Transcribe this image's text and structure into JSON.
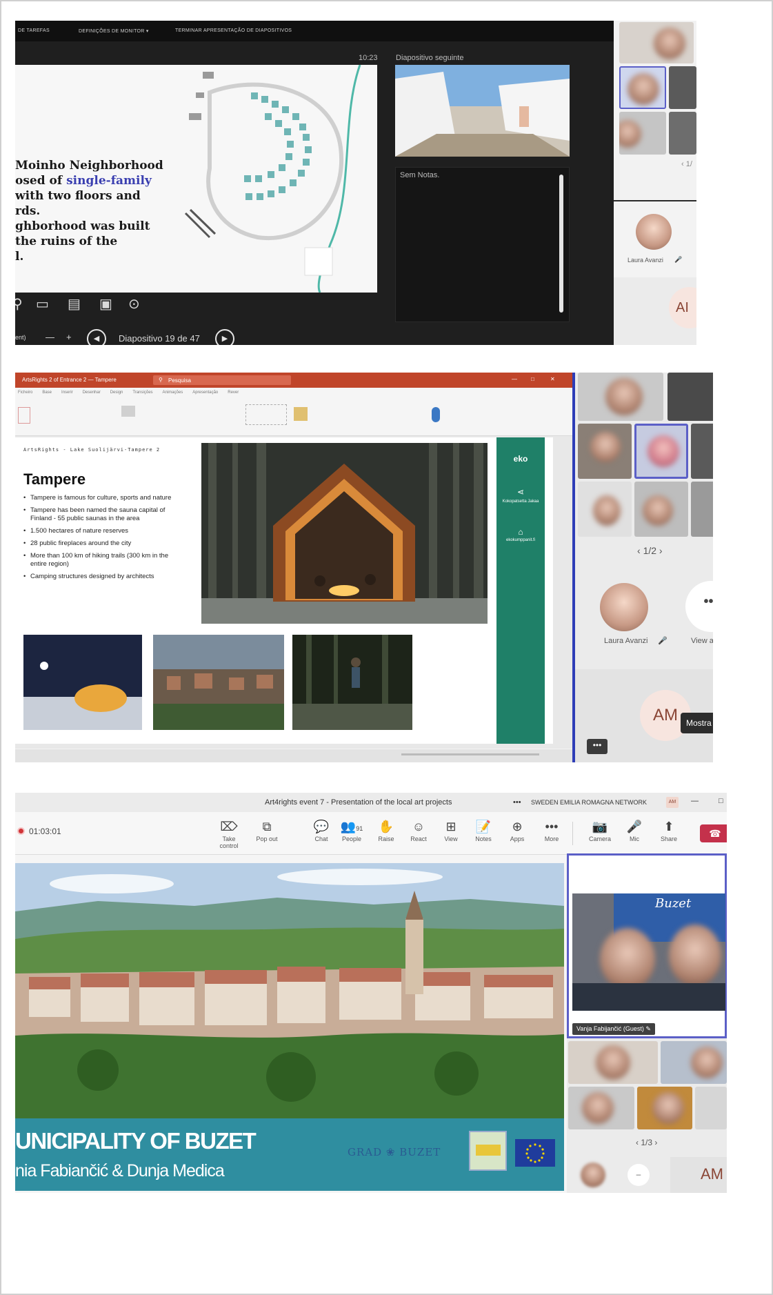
{
  "panel1": {
    "topbar_items": [
      "DE TAREFAS",
      "DEFINIÇÕES DE MONITOR ▾",
      "TERMINAR APRESENTAÇÃO DE DIAPOSITIVOS"
    ],
    "timer": "10:23",
    "slide_lines": [
      "Moinho Neighborhood",
      "osed of single-family",
      "with two floors and",
      "rds.",
      "ghborhood was built",
      "the ruins of the",
      "l."
    ],
    "next_slide_label": "Diapositivo seguinte",
    "notes_label": "Sem Notas.",
    "slide_counter": "Diapositivo 19 de 47",
    "zoom_label": "ent)",
    "zoom_minus": "—",
    "zoom_plus": "+",
    "page_indicator": "1/",
    "participant_name": "Laura Avanzi",
    "initials": "AI",
    "accent_color": "#5b5fc7"
  },
  "panel2": {
    "ppt_title": "ArtsRights 2 of Entrance 2 — Tampere",
    "ppt_search": "Pesquisa",
    "ribbon_tabs": [
      "Ficheiro",
      "Base",
      "Inserir",
      "Desenhar",
      "Design",
      "Transições",
      "Animações",
      "Apresentação",
      "Rever"
    ],
    "slide_header": "ArtsRights - Lake Suolijärvi-Tampere 2",
    "slide_title": "Tampere",
    "bullets": [
      "Tampere is famous for culture, sports and nature",
      "Tampere has been named the sauna capital of Finland - 55 public saunas in the area",
      "1.500 hectares of nature reserves",
      "28 public fireplaces around the city",
      "More than 100 km of hiking trails (300 km in the entire region)",
      "Camping structures designed by architects"
    ],
    "side_brand": "eko",
    "side_share": "Kokopatsetta Jakaa",
    "side_site": "ekokumppanit.fi",
    "pager": "1/2",
    "participant_name": "Laura Avanzi",
    "view_all": "View all",
    "initials": "AM",
    "more_dots": "•••",
    "mostra_label": "Mostra d",
    "small_dots": "•••"
  },
  "panel3": {
    "window_title": "Art4rights event 7 - Presentation of the local art projects",
    "window_extra": "•••",
    "org_name": "SWEDEN EMILIA ROMAGNA NETWORK",
    "org_badge": "AM",
    "window_controls": [
      "—",
      "□"
    ],
    "rec_time": "01:03:01",
    "toolbar": [
      {
        "icon": "take-control-icon",
        "glyph": "⌦",
        "label": "Take control"
      },
      {
        "icon": "pop-out-icon",
        "glyph": "⧉",
        "label": "Pop out"
      },
      {
        "icon": "chat-icon",
        "glyph": "💬",
        "label": "Chat"
      },
      {
        "icon": "people-icon",
        "glyph": "👥",
        "label": "People"
      },
      {
        "icon": "raise-hand-icon",
        "glyph": "✋",
        "label": "Raise"
      },
      {
        "icon": "react-icon",
        "glyph": "☺",
        "label": "React"
      },
      {
        "icon": "view-icon",
        "glyph": "⊞",
        "label": "View"
      },
      {
        "icon": "notes-icon",
        "glyph": "📝",
        "label": "Notes"
      },
      {
        "icon": "apps-icon",
        "glyph": "⊕",
        "label": "Apps"
      },
      {
        "icon": "more-icon",
        "glyph": "•••",
        "label": "More"
      },
      {
        "icon": "camera-icon",
        "glyph": "📷",
        "label": "Camera"
      },
      {
        "icon": "mic-icon",
        "glyph": "🎤",
        "label": "Mic"
      },
      {
        "icon": "share-icon",
        "glyph": "⬆",
        "label": "Share"
      }
    ],
    "people_count": "91",
    "leave_glyph": "☎",
    "banner_title": "UNICIPALITY OF BUZET",
    "banner_subtitle": "nia Fabiančić & Dunja Medica",
    "grad_logo": "GRAD ❀ BUZET",
    "speaker_name": "Vanja Fabijančić (Guest)",
    "pager": "1/3",
    "initials": "AM",
    "video_brand": "Buzet"
  },
  "colors": {
    "teams_purple": "#5b5fc7",
    "ppt_red": "#c0452a",
    "eko_green": "#1f8068",
    "banner_teal": "#2f8ea0",
    "leave_red": "#c4314b"
  }
}
